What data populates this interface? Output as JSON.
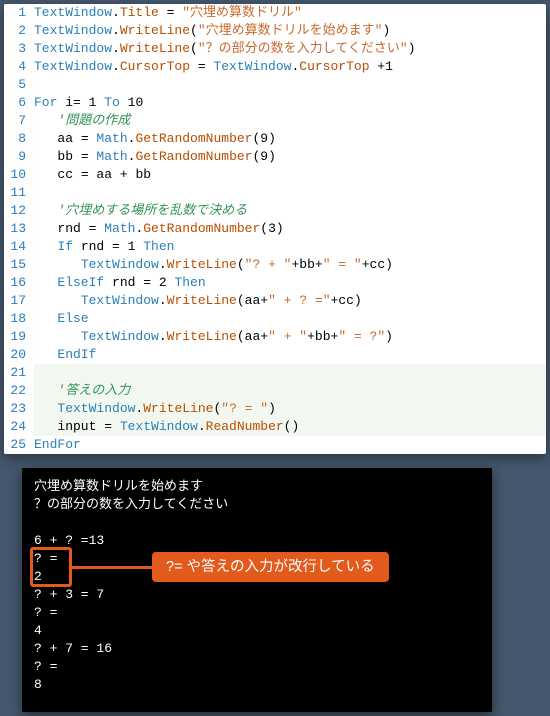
{
  "code": {
    "lines": [
      {
        "n": 1,
        "tokens": [
          [
            "type",
            "TextWindow"
          ],
          [
            "punct",
            "."
          ],
          [
            "method",
            "Title"
          ],
          [
            "punct",
            " = "
          ],
          [
            "string",
            "\"穴埋め算数ドリル\""
          ]
        ]
      },
      {
        "n": 2,
        "tokens": [
          [
            "type",
            "TextWindow"
          ],
          [
            "punct",
            "."
          ],
          [
            "method",
            "WriteLine"
          ],
          [
            "punct",
            "("
          ],
          [
            "string",
            "\"穴埋め算数ドリルを始めます\""
          ],
          [
            "punct",
            ")"
          ]
        ]
      },
      {
        "n": 3,
        "tokens": [
          [
            "type",
            "TextWindow"
          ],
          [
            "punct",
            "."
          ],
          [
            "method",
            "WriteLine"
          ],
          [
            "punct",
            "("
          ],
          [
            "string",
            "\"？の部分の数を入力してください\""
          ],
          [
            "punct",
            ")"
          ]
        ]
      },
      {
        "n": 4,
        "tokens": [
          [
            "type",
            "TextWindow"
          ],
          [
            "punct",
            "."
          ],
          [
            "method",
            "CursorTop"
          ],
          [
            "punct",
            " = "
          ],
          [
            "type",
            "TextWindow"
          ],
          [
            "punct",
            "."
          ],
          [
            "method",
            "CursorTop"
          ],
          [
            "punct",
            " +"
          ],
          [
            "number",
            "1"
          ]
        ]
      },
      {
        "n": 5,
        "tokens": []
      },
      {
        "n": 6,
        "tokens": [
          [
            "keyword",
            "For "
          ],
          [
            "ident",
            "i"
          ],
          [
            "op",
            "= "
          ],
          [
            "number",
            "1"
          ],
          [
            "keyword",
            " To "
          ],
          [
            "number",
            "10"
          ]
        ]
      },
      {
        "n": 7,
        "tokens": [
          [
            "ident",
            "   "
          ],
          [
            "comment",
            "'問題の作成"
          ]
        ]
      },
      {
        "n": 8,
        "tokens": [
          [
            "ident",
            "   aa"
          ],
          [
            "punct",
            " = "
          ],
          [
            "type",
            "Math"
          ],
          [
            "punct",
            "."
          ],
          [
            "method",
            "GetRandomNumber"
          ],
          [
            "punct",
            "("
          ],
          [
            "number",
            "9"
          ],
          [
            "punct",
            ")"
          ]
        ]
      },
      {
        "n": 9,
        "tokens": [
          [
            "ident",
            "   bb"
          ],
          [
            "punct",
            " = "
          ],
          [
            "type",
            "Math"
          ],
          [
            "punct",
            "."
          ],
          [
            "method",
            "GetRandomNumber"
          ],
          [
            "punct",
            "("
          ],
          [
            "number",
            "9"
          ],
          [
            "punct",
            ")"
          ]
        ]
      },
      {
        "n": 10,
        "tokens": [
          [
            "ident",
            "   cc"
          ],
          [
            "punct",
            " = "
          ],
          [
            "ident",
            "aa"
          ],
          [
            "punct",
            " + "
          ],
          [
            "ident",
            "bb"
          ]
        ]
      },
      {
        "n": 11,
        "tokens": []
      },
      {
        "n": 12,
        "tokens": [
          [
            "ident",
            "   "
          ],
          [
            "comment",
            "'穴埋めする場所を乱数で決める"
          ]
        ]
      },
      {
        "n": 13,
        "tokens": [
          [
            "ident",
            "   rnd"
          ],
          [
            "punct",
            " = "
          ],
          [
            "type",
            "Math"
          ],
          [
            "punct",
            "."
          ],
          [
            "method",
            "GetRandomNumber"
          ],
          [
            "punct",
            "("
          ],
          [
            "number",
            "3"
          ],
          [
            "punct",
            ")"
          ]
        ]
      },
      {
        "n": 14,
        "tokens": [
          [
            "ident",
            "   "
          ],
          [
            "keyword",
            "If "
          ],
          [
            "ident",
            "rnd"
          ],
          [
            "punct",
            " = "
          ],
          [
            "number",
            "1"
          ],
          [
            "keyword",
            " Then"
          ]
        ]
      },
      {
        "n": 15,
        "tokens": [
          [
            "ident",
            "      "
          ],
          [
            "type",
            "TextWindow"
          ],
          [
            "punct",
            "."
          ],
          [
            "method",
            "WriteLine"
          ],
          [
            "punct",
            "("
          ],
          [
            "string",
            "\"? + \""
          ],
          [
            "punct",
            "+"
          ],
          [
            "ident",
            "bb"
          ],
          [
            "punct",
            "+"
          ],
          [
            "string",
            "\" = \""
          ],
          [
            "punct",
            "+"
          ],
          [
            "ident",
            "cc"
          ],
          [
            "punct",
            ")"
          ]
        ]
      },
      {
        "n": 16,
        "tokens": [
          [
            "ident",
            "   "
          ],
          [
            "keyword",
            "ElseIf "
          ],
          [
            "ident",
            "rnd"
          ],
          [
            "punct",
            " = "
          ],
          [
            "number",
            "2"
          ],
          [
            "keyword",
            " Then"
          ]
        ]
      },
      {
        "n": 17,
        "tokens": [
          [
            "ident",
            "      "
          ],
          [
            "type",
            "TextWindow"
          ],
          [
            "punct",
            "."
          ],
          [
            "method",
            "WriteLine"
          ],
          [
            "punct",
            "("
          ],
          [
            "ident",
            "aa"
          ],
          [
            "punct",
            "+"
          ],
          [
            "string",
            "\" + ? =\""
          ],
          [
            "punct",
            "+"
          ],
          [
            "ident",
            "cc"
          ],
          [
            "punct",
            ")"
          ]
        ]
      },
      {
        "n": 18,
        "tokens": [
          [
            "ident",
            "   "
          ],
          [
            "keyword",
            "Else"
          ]
        ]
      },
      {
        "n": 19,
        "tokens": [
          [
            "ident",
            "      "
          ],
          [
            "type",
            "TextWindow"
          ],
          [
            "punct",
            "."
          ],
          [
            "method",
            "WriteLine"
          ],
          [
            "punct",
            "("
          ],
          [
            "ident",
            "aa"
          ],
          [
            "punct",
            "+"
          ],
          [
            "string",
            "\" + \""
          ],
          [
            "punct",
            "+"
          ],
          [
            "ident",
            "bb"
          ],
          [
            "punct",
            "+"
          ],
          [
            "string",
            "\" = ?\""
          ],
          [
            "punct",
            ")"
          ]
        ]
      },
      {
        "n": 20,
        "tokens": [
          [
            "ident",
            "   "
          ],
          [
            "keyword",
            "EndIf"
          ]
        ]
      },
      {
        "n": 21,
        "tokens": [],
        "current": true
      },
      {
        "n": 22,
        "tokens": [
          [
            "ident",
            "   "
          ],
          [
            "comment",
            "'答えの入力"
          ]
        ],
        "current": true
      },
      {
        "n": 23,
        "tokens": [
          [
            "ident",
            "   "
          ],
          [
            "type",
            "TextWindow"
          ],
          [
            "punct",
            "."
          ],
          [
            "method",
            "WriteLine"
          ],
          [
            "punct",
            "("
          ],
          [
            "string",
            "\"? = \""
          ],
          [
            "punct",
            ")"
          ]
        ],
        "current": true
      },
      {
        "n": 24,
        "tokens": [
          [
            "ident",
            "   input"
          ],
          [
            "punct",
            " = "
          ],
          [
            "type",
            "TextWindow"
          ],
          [
            "punct",
            "."
          ],
          [
            "method",
            "ReadNumber"
          ],
          [
            "punct",
            "()"
          ]
        ],
        "current": true
      },
      {
        "n": 25,
        "tokens": [
          [
            "keyword",
            "EndFor"
          ]
        ]
      }
    ]
  },
  "console": {
    "lines": [
      "穴埋め算数ドリルを始めます",
      "？の部分の数を入力してください",
      "",
      "6 + ? =13",
      "? =",
      "2",
      "? + 3 = 7",
      "? =",
      "4",
      "? + 7 = 16",
      "? =",
      "8"
    ]
  },
  "callout": {
    "label": "?= や答えの入力が改行している"
  }
}
